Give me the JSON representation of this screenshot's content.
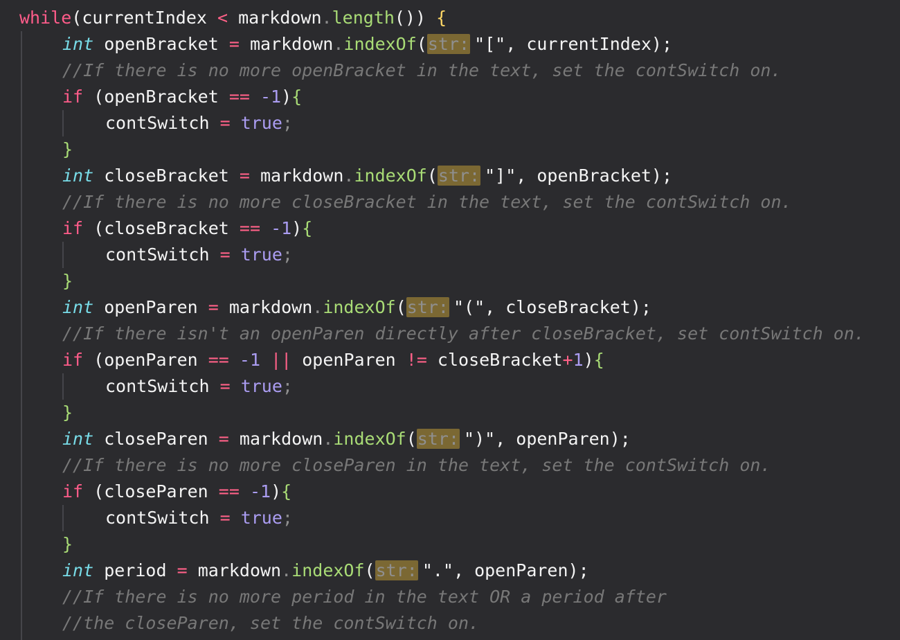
{
  "editor": {
    "background": "#2b2b2e",
    "parameter_hint_label": "str:",
    "lines": [
      {
        "indent": 0,
        "tokens": [
          {
            "t": "while",
            "c": "kw"
          },
          {
            "t": "(",
            "c": "plain"
          },
          {
            "t": "currentIndex",
            "c": "plain"
          },
          {
            "t": " ",
            "c": "plain"
          },
          {
            "t": "<",
            "c": "op"
          },
          {
            "t": " markdown",
            "c": "plain"
          },
          {
            "t": ".",
            "c": "punc"
          },
          {
            "t": "length",
            "c": "fn"
          },
          {
            "t": "())",
            "c": "plain"
          },
          {
            "t": " ",
            "c": "plain"
          },
          {
            "t": "{",
            "c": "brace1"
          }
        ]
      },
      {
        "indent": 1,
        "tokens": [
          {
            "t": "int",
            "c": "type"
          },
          {
            "t": " openBracket ",
            "c": "plain"
          },
          {
            "t": "=",
            "c": "op"
          },
          {
            "t": " markdown",
            "c": "plain"
          },
          {
            "t": ".",
            "c": "punc"
          },
          {
            "t": "indexOf",
            "c": "fn"
          },
          {
            "t": "(",
            "c": "plain"
          },
          {
            "hint": true
          },
          {
            "t": "\"[\"",
            "c": "plain"
          },
          {
            "t": ", currentIndex);",
            "c": "plain"
          }
        ]
      },
      {
        "indent": 1,
        "tokens": [
          {
            "t": "//If there is no more openBracket in the text, set the contSwitch on.",
            "c": "cmt"
          }
        ]
      },
      {
        "indent": 1,
        "tokens": [
          {
            "t": "if",
            "c": "kw"
          },
          {
            "t": " (openBracket ",
            "c": "plain"
          },
          {
            "t": "==",
            "c": "op"
          },
          {
            "t": " ",
            "c": "plain"
          },
          {
            "t": "-1",
            "c": "num"
          },
          {
            "t": ")",
            "c": "plain"
          },
          {
            "t": "{",
            "c": "brace2"
          }
        ]
      },
      {
        "indent": 2,
        "tokens": [
          {
            "t": "contSwitch ",
            "c": "plain"
          },
          {
            "t": "=",
            "c": "op"
          },
          {
            "t": " ",
            "c": "plain"
          },
          {
            "t": "true",
            "c": "num"
          },
          {
            "t": ";",
            "c": "punc"
          }
        ]
      },
      {
        "indent": 1,
        "tokens": [
          {
            "t": "}",
            "c": "brace2"
          }
        ]
      },
      {
        "indent": 1,
        "tokens": [
          {
            "t": "int",
            "c": "type"
          },
          {
            "t": " closeBracket ",
            "c": "plain"
          },
          {
            "t": "=",
            "c": "op"
          },
          {
            "t": " markdown",
            "c": "plain"
          },
          {
            "t": ".",
            "c": "punc"
          },
          {
            "t": "indexOf",
            "c": "fn"
          },
          {
            "t": "(",
            "c": "plain"
          },
          {
            "hint": true
          },
          {
            "t": "\"]\"",
            "c": "plain"
          },
          {
            "t": ", openBracket);",
            "c": "plain"
          }
        ]
      },
      {
        "indent": 1,
        "tokens": [
          {
            "t": "//If there is no more closeBracket in the text, set the contSwitch on.",
            "c": "cmt"
          }
        ]
      },
      {
        "indent": 1,
        "tokens": [
          {
            "t": "if",
            "c": "kw"
          },
          {
            "t": " (closeBracket ",
            "c": "plain"
          },
          {
            "t": "==",
            "c": "op"
          },
          {
            "t": " ",
            "c": "plain"
          },
          {
            "t": "-1",
            "c": "num"
          },
          {
            "t": ")",
            "c": "plain"
          },
          {
            "t": "{",
            "c": "brace2"
          }
        ]
      },
      {
        "indent": 2,
        "tokens": [
          {
            "t": "contSwitch ",
            "c": "plain"
          },
          {
            "t": "=",
            "c": "op"
          },
          {
            "t": " ",
            "c": "plain"
          },
          {
            "t": "true",
            "c": "num"
          },
          {
            "t": ";",
            "c": "punc"
          }
        ]
      },
      {
        "indent": 1,
        "tokens": [
          {
            "t": "}",
            "c": "brace2"
          }
        ]
      },
      {
        "indent": 1,
        "tokens": [
          {
            "t": "int",
            "c": "type"
          },
          {
            "t": " openParen ",
            "c": "plain"
          },
          {
            "t": "=",
            "c": "op"
          },
          {
            "t": " markdown",
            "c": "plain"
          },
          {
            "t": ".",
            "c": "punc"
          },
          {
            "t": "indexOf",
            "c": "fn"
          },
          {
            "t": "(",
            "c": "plain"
          },
          {
            "hint": true
          },
          {
            "t": "\"(\"",
            "c": "plain"
          },
          {
            "t": ", closeBracket);",
            "c": "plain"
          }
        ]
      },
      {
        "indent": 1,
        "tokens": [
          {
            "t": "//If there isn't an openParen directly after closeBracket, set contSwitch on.",
            "c": "cmt"
          }
        ]
      },
      {
        "indent": 1,
        "tokens": [
          {
            "t": "if",
            "c": "kw"
          },
          {
            "t": " (openParen ",
            "c": "plain"
          },
          {
            "t": "==",
            "c": "op"
          },
          {
            "t": " ",
            "c": "plain"
          },
          {
            "t": "-1",
            "c": "num"
          },
          {
            "t": " ",
            "c": "plain"
          },
          {
            "t": "||",
            "c": "op"
          },
          {
            "t": " openParen ",
            "c": "plain"
          },
          {
            "t": "!=",
            "c": "op"
          },
          {
            "t": " closeBracket",
            "c": "plain"
          },
          {
            "t": "+",
            "c": "op"
          },
          {
            "t": "1",
            "c": "num"
          },
          {
            "t": ")",
            "c": "plain"
          },
          {
            "t": "{",
            "c": "brace2"
          }
        ]
      },
      {
        "indent": 2,
        "tokens": [
          {
            "t": "contSwitch ",
            "c": "plain"
          },
          {
            "t": "=",
            "c": "op"
          },
          {
            "t": " ",
            "c": "plain"
          },
          {
            "t": "true",
            "c": "num"
          },
          {
            "t": ";",
            "c": "punc"
          }
        ]
      },
      {
        "indent": 1,
        "tokens": [
          {
            "t": "}",
            "c": "brace2"
          }
        ]
      },
      {
        "indent": 1,
        "tokens": [
          {
            "t": "int",
            "c": "type"
          },
          {
            "t": " closeParen ",
            "c": "plain"
          },
          {
            "t": "=",
            "c": "op"
          },
          {
            "t": " markdown",
            "c": "plain"
          },
          {
            "t": ".",
            "c": "punc"
          },
          {
            "t": "indexOf",
            "c": "fn"
          },
          {
            "t": "(",
            "c": "plain"
          },
          {
            "hint": true
          },
          {
            "t": "\")\"",
            "c": "plain"
          },
          {
            "t": ", openParen);",
            "c": "plain"
          }
        ]
      },
      {
        "indent": 1,
        "tokens": [
          {
            "t": "//If there is no more closeParen in the text, set the contSwitch on.",
            "c": "cmt"
          }
        ]
      },
      {
        "indent": 1,
        "tokens": [
          {
            "t": "if",
            "c": "kw"
          },
          {
            "t": " (closeParen ",
            "c": "plain"
          },
          {
            "t": "==",
            "c": "op"
          },
          {
            "t": " ",
            "c": "plain"
          },
          {
            "t": "-1",
            "c": "num"
          },
          {
            "t": ")",
            "c": "plain"
          },
          {
            "t": "{",
            "c": "brace2"
          }
        ]
      },
      {
        "indent": 2,
        "tokens": [
          {
            "t": "contSwitch ",
            "c": "plain"
          },
          {
            "t": "=",
            "c": "op"
          },
          {
            "t": " ",
            "c": "plain"
          },
          {
            "t": "true",
            "c": "num"
          },
          {
            "t": ";",
            "c": "punc"
          }
        ]
      },
      {
        "indent": 1,
        "tokens": [
          {
            "t": "}",
            "c": "brace2"
          }
        ]
      },
      {
        "indent": 1,
        "tokens": [
          {
            "t": "int",
            "c": "type"
          },
          {
            "t": " period ",
            "c": "plain"
          },
          {
            "t": "=",
            "c": "op"
          },
          {
            "t": " markdown",
            "c": "plain"
          },
          {
            "t": ".",
            "c": "punc"
          },
          {
            "t": "indexOf",
            "c": "fn"
          },
          {
            "t": "(",
            "c": "plain"
          },
          {
            "hint": true
          },
          {
            "t": "\".\"",
            "c": "plain"
          },
          {
            "t": ", openParen);",
            "c": "plain"
          }
        ]
      },
      {
        "indent": 1,
        "tokens": [
          {
            "t": "//If there is no more period in the text OR a period after",
            "c": "cmt"
          }
        ]
      },
      {
        "indent": 1,
        "tokens": [
          {
            "t": "//the closeParen, set the contSwitch on.",
            "c": "cmt"
          }
        ]
      }
    ]
  }
}
